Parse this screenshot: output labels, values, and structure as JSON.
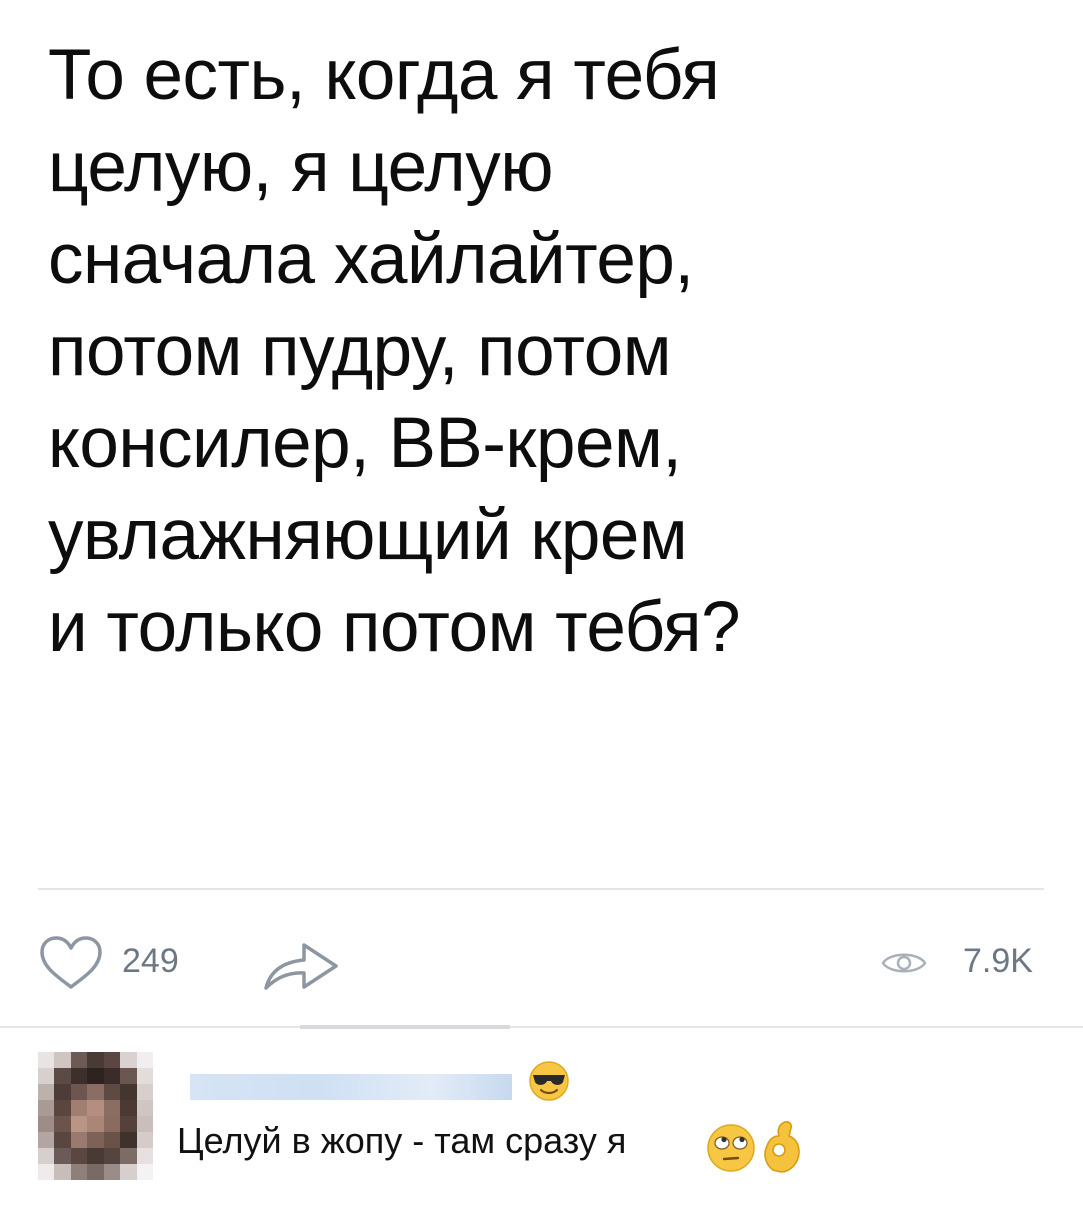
{
  "post": {
    "text_lines": [
      "То есть, когда я тебя",
      "целую, я целую",
      "сначала хайлайтер,",
      "потом пудру, потом",
      "консилер, ВВ-крем,",
      "увлажняющий крем",
      "и только потом тебя?"
    ]
  },
  "actions": {
    "like_icon": "heart-outline-icon",
    "like_count": "249",
    "share_icon": "share-arrow-icon",
    "views_icon": "eye-icon",
    "views_count": "7.9K"
  },
  "comment": {
    "author_badge_icon": "sunglasses-emoji-icon",
    "text": "Целуй в жопу - там сразу я",
    "trailing_emojis": [
      "rolling-eyes-emoji-icon",
      "ok-hand-emoji-icon"
    ]
  },
  "colors": {
    "text": "#0d0d0d",
    "meta": "#6d7885",
    "divider": "#e3e5e8",
    "icon": "#8d96a1"
  }
}
